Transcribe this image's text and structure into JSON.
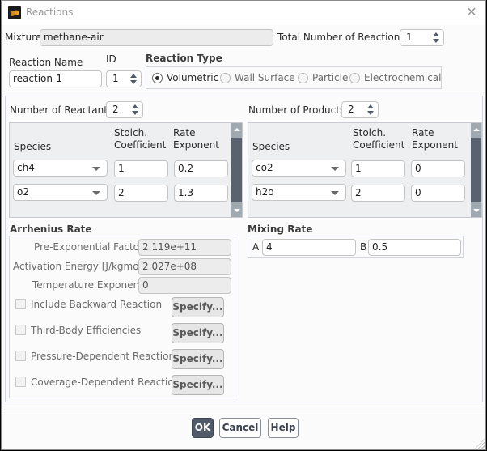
{
  "window": {
    "title": "Reactions",
    "app_icon": "fluent-app-icon",
    "close_icon": "close-icon"
  },
  "top": {
    "mixture_label": "Mixture",
    "mixture_value": "methane-air",
    "total_reactions_label": "Total Number of Reactions",
    "total_reactions_value": "1",
    "reaction_name_label": "Reaction Name",
    "reaction_name_value": "reaction-1",
    "id_label": "ID",
    "id_value": "1"
  },
  "reaction_type": {
    "title": "Reaction Type",
    "options": [
      {
        "label": "Volumetric",
        "selected": true,
        "enabled": true
      },
      {
        "label": "Wall Surface",
        "selected": false,
        "enabled": false
      },
      {
        "label": "Particle",
        "selected": false,
        "enabled": false
      },
      {
        "label": "Electrochemical",
        "selected": false,
        "enabled": false
      }
    ]
  },
  "reactants": {
    "count_label": "Number of Reactants",
    "count_value": "2",
    "columns": [
      "Species",
      "Stoich.\nCoefficient",
      "Rate\nExponent"
    ],
    "col_species": "Species",
    "col_stoich_1": "Stoich.",
    "col_stoich_2": "Coefficient",
    "col_rate_1": "Rate",
    "col_rate_2": "Exponent",
    "rows": [
      {
        "species": "ch4",
        "stoich": "1",
        "rate_exponent": "0.2"
      },
      {
        "species": "o2",
        "stoich": "2",
        "rate_exponent": "1.3"
      }
    ]
  },
  "products": {
    "count_label": "Number of Products",
    "count_value": "2",
    "col_species": "Species",
    "col_stoich_1": "Stoich.",
    "col_stoich_2": "Coefficient",
    "col_rate_1": "Rate",
    "col_rate_2": "Exponent",
    "rows": [
      {
        "species": "co2",
        "stoich": "1",
        "rate_exponent": "0"
      },
      {
        "species": "h2o",
        "stoich": "2",
        "rate_exponent": "0"
      }
    ]
  },
  "arrhenius": {
    "title": "Arrhenius Rate",
    "pre_exp_label": "Pre-Exponential Factor",
    "pre_exp_value": "2.119e+11",
    "activation_label": "Activation Energy [J/kgmol]",
    "activation_value": "2.027e+08",
    "temp_exp_label": "Temperature Exponent",
    "temp_exp_value": "0",
    "options": [
      {
        "label": "Include Backward Reaction",
        "checked": false,
        "button": "Specify..."
      },
      {
        "label": "Third-Body Efficiencies",
        "checked": false,
        "button": "Specify..."
      },
      {
        "label": "Pressure-Dependent Reaction",
        "checked": false,
        "button": "Specify..."
      },
      {
        "label": "Coverage-Dependent Reaction",
        "checked": false,
        "button": "Specify..."
      }
    ]
  },
  "mixing_rate": {
    "title": "Mixing Rate",
    "a_label": "A",
    "a_value": "4",
    "b_label": "B",
    "b_value": "0.5"
  },
  "footer": {
    "ok": "OK",
    "cancel": "Cancel",
    "help": "Help"
  },
  "colors": {
    "primary_button": "#505a68",
    "scroll_thumb": "#5a6270"
  }
}
